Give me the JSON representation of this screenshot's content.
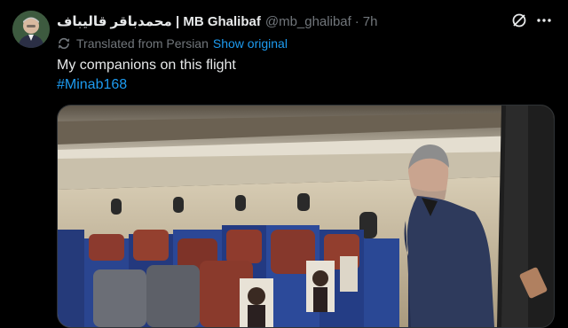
{
  "author": {
    "display_name": "محمدباقر قالیباف | MB Ghalibaf",
    "handle": "@mb_ghalibaf",
    "separator": "·",
    "time": "7h"
  },
  "icons": {
    "avatar": "avatar",
    "grok": "grok-icon",
    "more": "more-icon",
    "translate": "translate-icon"
  },
  "translation": {
    "label": "Translated from Persian",
    "link": "Show original"
  },
  "tweet": {
    "text": "My companions on this flight",
    "hashtag": "#Minab168"
  },
  "media": {
    "description_icon": "photo"
  },
  "colors": {
    "background": "#000000",
    "text": "#e7e9ea",
    "muted": "#71767b",
    "link": "#1d9bf0"
  }
}
